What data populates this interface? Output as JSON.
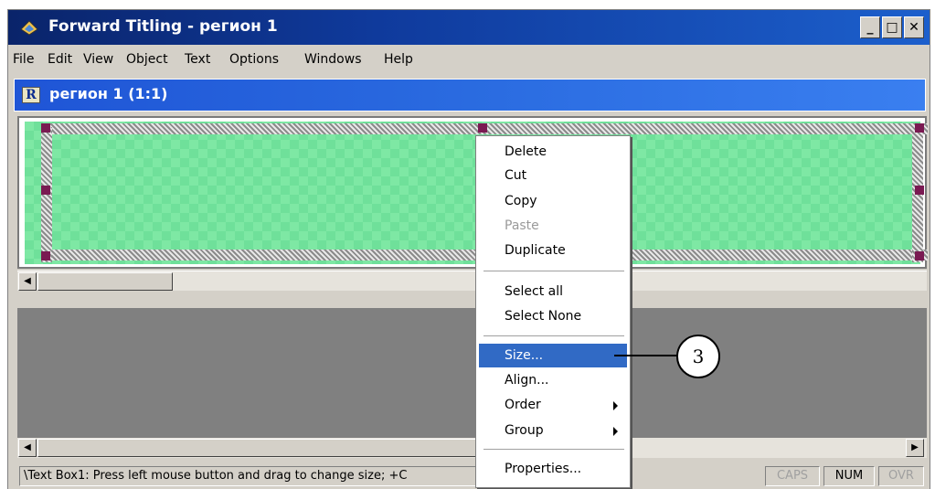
{
  "window": {
    "title": "Forward Titling - регион 1",
    "minimize_label": "_",
    "maximize_label": "□",
    "close_label": "✕"
  },
  "menubar": {
    "items": [
      "File",
      "Edit",
      "View",
      "Object",
      "Text",
      "Options",
      "Windows",
      "Help"
    ]
  },
  "mdi": {
    "icon_letter": "R",
    "title": "регион 1  (1:1)"
  },
  "statusbar": {
    "message": "\\Text Box1: Press left mouse button and drag to change size; +C",
    "indicators": [
      "CAPS",
      "NUM",
      "OVR"
    ],
    "active_indicator": "NUM"
  },
  "context_menu": {
    "items": [
      {
        "label": "Delete",
        "state": "normal"
      },
      {
        "label": "Cut",
        "state": "normal"
      },
      {
        "label": "Copy",
        "state": "normal"
      },
      {
        "label": "Paste",
        "state": "disabled"
      },
      {
        "label": "Duplicate",
        "state": "normal"
      },
      {
        "label": "Select all",
        "state": "normal"
      },
      {
        "label": "Select None",
        "state": "normal"
      },
      {
        "label": "Size...",
        "state": "selected"
      },
      {
        "label": "Align...",
        "state": "normal"
      },
      {
        "label": "Order",
        "state": "normal",
        "submenu": true
      },
      {
        "label": "Group",
        "state": "normal",
        "submenu": true
      },
      {
        "label": "Properties...",
        "state": "normal"
      }
    ]
  },
  "callout": {
    "number": "3"
  },
  "colors": {
    "title_bar": "#0a246a",
    "mdi_title": "#2a6be0",
    "canvas_green": "#7ee8a4",
    "selection_handle": "#7a1a52",
    "menu_highlight": "#316ac5"
  }
}
